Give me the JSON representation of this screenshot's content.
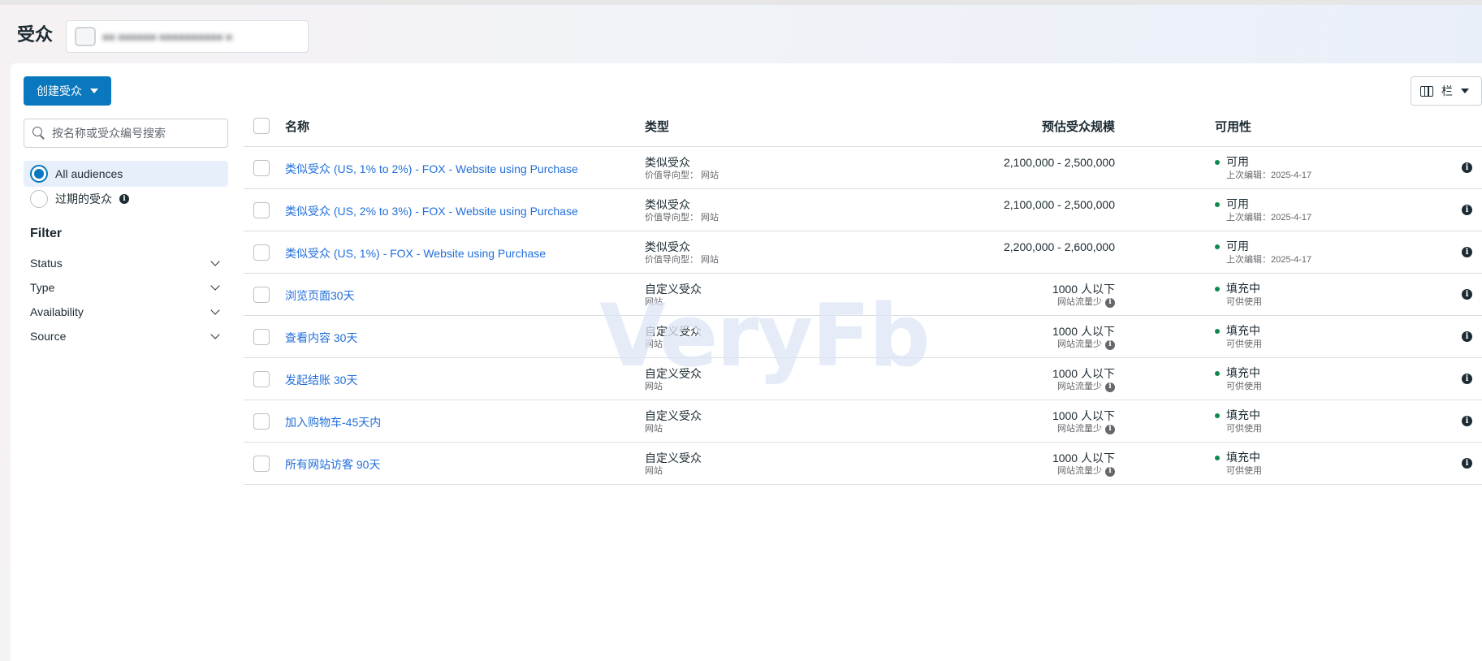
{
  "header": {
    "title": "受众",
    "account_name": "■■ ■■■■■■ ■■■■■■■■■■ ■"
  },
  "toolbar": {
    "create_label": "创建受众",
    "columns_label": "栏"
  },
  "sidebar": {
    "search_placeholder": "按名称或受众编号搜索",
    "scope_options": [
      {
        "label": "All audiences",
        "selected": true
      },
      {
        "label": "过期的受众",
        "selected": false
      }
    ],
    "filter_title": "Filter",
    "filters": [
      "Status",
      "Type",
      "Availability",
      "Source"
    ]
  },
  "table": {
    "headers": {
      "name": "名称",
      "type": "类型",
      "size": "预估受众规模",
      "availability": "可用性"
    },
    "rows": [
      {
        "name": "类似受众 (US, 1% to 2%) - FOX - Website using Purchase",
        "type": "类似受众",
        "type_sub": "价值导向型： 网站",
        "size": "2,100,000 - 2,500,000",
        "size_sub": "",
        "status": "可用",
        "status_sub": "上次编辑：2025-4-17"
      },
      {
        "name": "类似受众 (US, 2% to 3%) - FOX - Website using Purchase",
        "type": "类似受众",
        "type_sub": "价值导向型： 网站",
        "size": "2,100,000 - 2,500,000",
        "size_sub": "",
        "status": "可用",
        "status_sub": "上次编辑：2025-4-17"
      },
      {
        "name": "类似受众 (US, 1%) - FOX - Website using Purchase",
        "type": "类似受众",
        "type_sub": "价值导向型： 网站",
        "size": "2,200,000 - 2,600,000",
        "size_sub": "",
        "status": "可用",
        "status_sub": "上次编辑：2025-4-17"
      },
      {
        "name": "浏览页面30天",
        "type": "自定义受众",
        "type_sub": "网站",
        "size": "1000 人以下",
        "size_sub": "网站流量少",
        "status": "填充中",
        "status_sub": "可供使用"
      },
      {
        "name": "查看内容 30天",
        "type": "自定义受众",
        "type_sub": "网站",
        "size": "1000 人以下",
        "size_sub": "网站流量少",
        "status": "填充中",
        "status_sub": "可供使用"
      },
      {
        "name": "发起结账 30天",
        "type": "自定义受众",
        "type_sub": "网站",
        "size": "1000 人以下",
        "size_sub": "网站流量少",
        "status": "填充中",
        "status_sub": "可供使用"
      },
      {
        "name": "加入购物车-45天内",
        "type": "自定义受众",
        "type_sub": "网站",
        "size": "1000 人以下",
        "size_sub": "网站流量少",
        "status": "填充中",
        "status_sub": "可供使用"
      },
      {
        "name": "所有网站访客 90天",
        "type": "自定义受众",
        "type_sub": "网站",
        "size": "1000 人以下",
        "size_sub": "网站流量少",
        "status": "填充中",
        "status_sub": "可供使用"
      }
    ]
  },
  "watermark": "VeryFb",
  "colors": {
    "accent": "#0a78be",
    "link": "#216fdb",
    "status_green": "#0e8a4e"
  },
  "icons": {
    "search": "search-icon",
    "info": "info-icon",
    "columns": "columns-icon",
    "chevron": "chevron-down-icon"
  }
}
